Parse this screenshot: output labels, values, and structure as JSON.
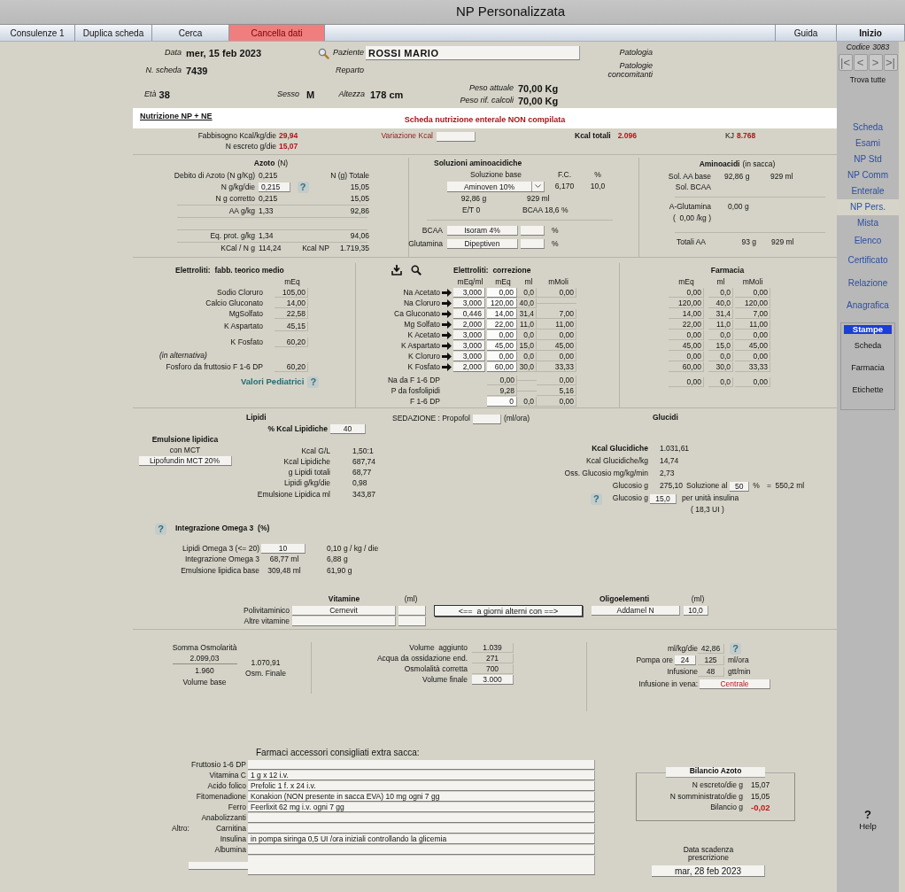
{
  "window": {
    "title": "NP Personalizzata"
  },
  "toolbar": {
    "left": [
      {
        "label": "Consulenze 1",
        "kind": "tab"
      },
      {
        "label": "Duplica scheda",
        "kind": "tab"
      },
      {
        "label": "Cerca",
        "kind": "tab"
      },
      {
        "label": "Cancella dati",
        "kind": "danger"
      }
    ],
    "right": [
      {
        "label": "Guida",
        "kind": "tab"
      },
      {
        "label": "Inizio",
        "kind": "strong"
      }
    ]
  },
  "header": {
    "date": {
      "label": "Data",
      "value": "mer, 15 feb 2023"
    },
    "card_number": {
      "label": "N. scheda",
      "value": "7439"
    },
    "patient": {
      "label": "Paziente",
      "value": "ROSSI MARIO"
    },
    "ward": {
      "label": "Reparto"
    },
    "pathology": {
      "label": "Patologia"
    },
    "comorbidities": {
      "label": "Patologie concomitanti"
    },
    "age": {
      "label": "Età",
      "value": "38"
    },
    "sex": {
      "label": "Sesso",
      "value": "M"
    },
    "height": {
      "label": "Altezza",
      "value": "178 cm"
    },
    "current_weight": {
      "label": "Peso attuale",
      "value": "70,00 Kg"
    },
    "reference_weight": {
      "label": "Peso rif. calcoli",
      "value": "70,00 Kg"
    }
  },
  "banner": {
    "title": "Nutrizione NP + NE",
    "warning": "Scheda nutrizione enterale NON compilata"
  },
  "summary": {
    "requirement": {
      "label": "Fabbisogno Kcal/kg/die",
      "value": "29,94"
    },
    "n_excreted": {
      "label": "N escreto g/die",
      "value": "15,07"
    },
    "kcal_variation": {
      "label": "Variazione Kcal"
    },
    "kcal_total": {
      "label": "Kcal totali",
      "value": "2.096"
    },
    "kj": {
      "label": "KJ",
      "value": "8.768"
    }
  },
  "nitrogen": {
    "title": "Azoto",
    "title_note": "(N)",
    "total_header": "N (g) Totale",
    "rows": [
      {
        "label": "Debito di Azoto (N g/Kg)",
        "value": "0,215"
      },
      {
        "label": "N g/kg/die",
        "value": "0,215",
        "kind": "input",
        "help": "?",
        "total": "15,05"
      },
      {
        "label": "N g corretto",
        "value": "0,215",
        "total": "15,05"
      },
      {
        "label": "AA g/kg",
        "value": "1,33",
        "total": "92,86"
      },
      {
        "label": "Eq. prot. g/kg",
        "value": "1,34",
        "total": "94,06"
      },
      {
        "label": "KCal / N g",
        "value": "114,24",
        "total_label": "Kcal NP",
        "total": "1.719,35"
      }
    ]
  },
  "amino_solutions": {
    "title": "Soluzioni aminoacidiche",
    "headers": [
      "Soluzione base",
      "F.C.",
      "%"
    ],
    "base": {
      "value": "Aminoven 10%",
      "fc": "6,170",
      "percent": "10,0"
    },
    "grams": "92,86 g",
    "ml": "929 ml",
    "et": "E/T 0",
    "bcaa_share": "BCAA 18,6 %",
    "additives": [
      {
        "label": "BCAA",
        "value": "Isoram 4%",
        "unit": "%"
      },
      {
        "label": "Glutamina",
        "value": "Dipeptiven",
        "unit": "%"
      }
    ]
  },
  "amino_in_bag": {
    "title": "Aminoacidi",
    "title_note": "(in sacca)",
    "rows": [
      {
        "label": "Sol. AA base",
        "grams": "92,86 g",
        "ml": "929 ml"
      },
      {
        "label": "Sol. BCAA"
      }
    ],
    "glutamine": {
      "label": "A-Glutamina",
      "value": "0,00 g",
      "per_kg": "(  0,00 /kg )"
    },
    "total": {
      "label": "Totali AA",
      "grams": "93 g",
      "ml": "929 ml"
    }
  },
  "electrolytes_theoretical": {
    "title": "Elettroliti:  fabb. teorico medio",
    "unit_header": "mEq",
    "rows": [
      {
        "label": "Sodio Cloruro",
        "value": "105,00"
      },
      {
        "label": "Calcio Gluconato",
        "value": "14,00"
      },
      {
        "label": "MgSolfato",
        "value": "22,58"
      },
      {
        "label": "K Aspartato",
        "value": "45,15"
      },
      {
        "label": "K Fosfato",
        "value": "60,20"
      }
    ],
    "alternative_note": "(in alternativa)",
    "alternative": {
      "label": "Fosforo da fruttosio F 1-6 DP",
      "value": "60,20"
    },
    "pediatric": {
      "label": "Valori Pediatrici",
      "help": "?"
    }
  },
  "electrolytes_correction": {
    "title": "Elettroliti:  correzione",
    "headers": [
      "mEq/ml",
      "mEq",
      "ml",
      "mMoli"
    ],
    "rows": [
      {
        "name": "Na Acetato",
        "meq_ml": "3,000",
        "meq": "0,00",
        "ml": "0,0",
        "mmoli": "0,00"
      },
      {
        "name": "Na Cloruro",
        "meq_ml": "3,000",
        "meq": "120,00",
        "ml": "40,0"
      },
      {
        "name": "Ca Gluconato",
        "meq_ml": "0,446",
        "meq": "14,00",
        "ml": "31,4",
        "mmoli": "7,00"
      },
      {
        "name": "Mg Solfato",
        "meq_ml": "2,000",
        "meq": "22,00",
        "ml": "11,0",
        "mmoli": "11,00"
      },
      {
        "name": "K Acetato",
        "meq_ml": "3,000",
        "meq": "0,00",
        "ml": "0,0",
        "mmoli": "0,00"
      },
      {
        "name": "K Aspartato",
        "meq_ml": "3,000",
        "meq": "45,00",
        "ml": "15,0",
        "mmoli": "45,00"
      },
      {
        "name": "K Cloruro",
        "meq_ml": "3,000",
        "meq": "0,00",
        "ml": "0,0",
        "mmoli": "0,00"
      },
      {
        "name": "K Fosfato",
        "meq_ml": "2,000",
        "meq": "60,00",
        "ml": "30,0",
        "mmoli": "33,33"
      }
    ],
    "extra_rows": [
      {
        "name": "Na da F 1-6 DP",
        "meq": "0,00",
        "mmoli": "0,00"
      },
      {
        "name": "P da fosfolipidi",
        "meq": "9,28",
        "mmoli": "5,16"
      },
      {
        "name": "F 1-6 DP",
        "meq": "0",
        "ml": "0,0",
        "mmoli": "0,00",
        "kind": "input"
      }
    ]
  },
  "pharmacy": {
    "title": "Farmacia",
    "headers": [
      "mEq",
      "ml",
      "mMoli"
    ],
    "rows": [
      {
        "meq": "0,00",
        "ml": "0,0",
        "mmoli": "0,00"
      },
      {
        "meq": "120,00",
        "ml": "40,0",
        "mmoli": "120,00"
      },
      {
        "meq": "14,00",
        "ml": "31,4",
        "mmoli": "7,00"
      },
      {
        "meq": "22,00",
        "ml": "11,0",
        "mmoli": "11,00"
      },
      {
        "meq": "0,00",
        "ml": "0,0",
        "mmoli": "0,00"
      },
      {
        "meq": "45,00",
        "ml": "15,0",
        "mmoli": "45,00"
      },
      {
        "meq": "0,00",
        "ml": "0,0",
        "mmoli": "0,00"
      },
      {
        "meq": "60,00",
        "ml": "30,0",
        "mmoli": "33,33"
      },
      {
        "meq": "0,00",
        "ml": "0,0",
        "mmoli": "0,00"
      }
    ]
  },
  "lipids": {
    "title": "Lipidi",
    "kcal_share": {
      "label": "% Kcal Lipidiche",
      "value": "40"
    },
    "emulsion": {
      "title": "Emulsione lipidica",
      "subtitle": "con MCT",
      "value": "Lipofundin MCT 20%"
    },
    "rows": [
      {
        "label": "Kcal G/L",
        "value": "1,50:1"
      },
      {
        "label": "Kcal Lipidiche",
        "value": "687,74"
      },
      {
        "label": "g Lipidi totali",
        "value": "68,77"
      },
      {
        "label": "Lipidi g/kg/die",
        "value": "0,98"
      },
      {
        "label": "Emulsione Lipidica ml",
        "value": "343,87"
      }
    ]
  },
  "sedation": {
    "label": "SEDAZIONE : Propofol",
    "unit": "(ml/ora)"
  },
  "glucides": {
    "title": "Glucidi",
    "rows": [
      {
        "label": "Kcal Glucidiche",
        "value": "1.031,61",
        "kind": "strong"
      },
      {
        "label": "Kcal Glucidiche/kg",
        "value": "14,74"
      },
      {
        "label": "Oss. Glucosio mg/kg/min",
        "value": "2,73"
      }
    ],
    "glucose": {
      "label": "Glucosio g",
      "value": "275,10",
      "solution_label": "Soluzione al",
      "solution": "50",
      "unit": "%",
      "result": "=  550,2 ml"
    },
    "insulin": {
      "help": "?",
      "label": "Glucosio g",
      "value": "15,0",
      "unit": "per unità insulina",
      "result": "( 18,3 UI )"
    }
  },
  "omega3": {
    "help": "?",
    "title": "Integrazione Omega 3  (%)",
    "rows": [
      {
        "label": "Lipidi Omega 3 (<= 20)",
        "value": "10",
        "kind": "input",
        "extra": "0,10 g / kg / die"
      },
      {
        "label": "Integrazione Omega 3",
        "value": "68,77 ml",
        "extra": "6,88 g"
      },
      {
        "label": "Emulsione lipidica base",
        "value": "309,48 ml",
        "extra": "61,90 g"
      }
    ]
  },
  "vitamins": {
    "title": "Vitamine",
    "unit": "(ml)",
    "rows": [
      {
        "label": "Polivitaminico",
        "value": "Cernevit"
      },
      {
        "label": "Altre vitamine"
      }
    ],
    "alternate_button": "<==  a giorni alterni con ==>"
  },
  "trace_elements": {
    "title": "Oligoelementi",
    "unit": "(ml)",
    "value": "Addamel N",
    "ml": "10,0"
  },
  "osmolarity": {
    "sum_label": "Somma Osmolarità",
    "sum": "2.099,03",
    "base": "1.960",
    "base_label": "Volume base",
    "final": "1.070,91",
    "final_label": "Osm. Finale"
  },
  "volume": {
    "rows": [
      {
        "label": "Volume  aggiunto",
        "value": "1.039"
      },
      {
        "label": "Acqua da ossidazione end.",
        "value": "271"
      },
      {
        "label": "Osmolalità corretta",
        "value": "700"
      },
      {
        "label": "Volume finale",
        "value": "3.000",
        "kind": "input"
      }
    ]
  },
  "infusion": {
    "ml_kg": {
      "label": "ml/kg/die",
      "value": "42,86",
      "help": "?"
    },
    "pump": {
      "label": "Pompa ore",
      "hours": "24",
      "rate": "125",
      "unit": "ml/ora"
    },
    "drip": {
      "label": "Infusione",
      "value": "48",
      "unit": "gtt/min"
    },
    "route": {
      "label": "Infusione in vena:",
      "value": "Centrale"
    }
  },
  "extra_drugs": {
    "title": "Farmaci accessori consigliati extra sacca:",
    "other_label": "Altro:",
    "rows": [
      {
        "label": "Fruttosio 1-6 DP"
      },
      {
        "label": "Vitamina C",
        "value": "1 g x 12 i.v."
      },
      {
        "label": "Acido folico",
        "value": "Prefolic 1 f. x 24 i.v."
      },
      {
        "label": "Fitomenadione",
        "value": "Konakion (NON presente in sacca EVA) 10 mg ogni 7 gg"
      },
      {
        "label": "Ferro",
        "value": "Feerlixit 62 mg i.v. ogni 7 gg"
      },
      {
        "label": "Anabolizzanti"
      },
      {
        "label": "Carnitina"
      },
      {
        "label": "Insulina",
        "value": "in pompa siringa 0,5 UI /ora iniziali controllando la glicemia"
      },
      {
        "label": "Albumina"
      }
    ]
  },
  "nitrogen_balance": {
    "title": "Bilancio Azoto",
    "rows": [
      {
        "label": "N escreto/die g",
        "value": "15,07"
      },
      {
        "label": "N somministrato/die g",
        "value": "15,05"
      },
      {
        "label": "Bilancio g",
        "value": "-0,02",
        "kind": "alert"
      }
    ]
  },
  "expiry": {
    "label": "Data scadenza prescrizione",
    "value": "mar, 28 feb 2023"
  },
  "sidebar": {
    "code_label": "Codice",
    "code": "3083",
    "nav": [
      "|<",
      "<",
      ">",
      ">|"
    ],
    "find_all": "Trova tutte",
    "items": [
      {
        "label": "Scheda",
        "selected": false
      },
      {
        "label": "Esami",
        "selected": false
      },
      {
        "label": "NP Std",
        "selected": false
      },
      {
        "label": "NP Comm",
        "selected": false
      },
      {
        "label": "Enterale",
        "selected": false
      },
      {
        "label": "NP Pers.",
        "selected": true
      },
      {
        "label": "Mista",
        "selected": false
      },
      {
        "label": "Elenco",
        "selected": false
      },
      {
        "label": "Certificato",
        "selected": false
      },
      {
        "label": "Relazione",
        "selected": false
      },
      {
        "label": "Anagrafica",
        "selected": false
      }
    ],
    "print_menu": {
      "title": "Stampe",
      "items": [
        "Scheda",
        "Farmacia",
        "Etichette"
      ]
    },
    "help": {
      "icon": "?",
      "label": "Help"
    }
  }
}
